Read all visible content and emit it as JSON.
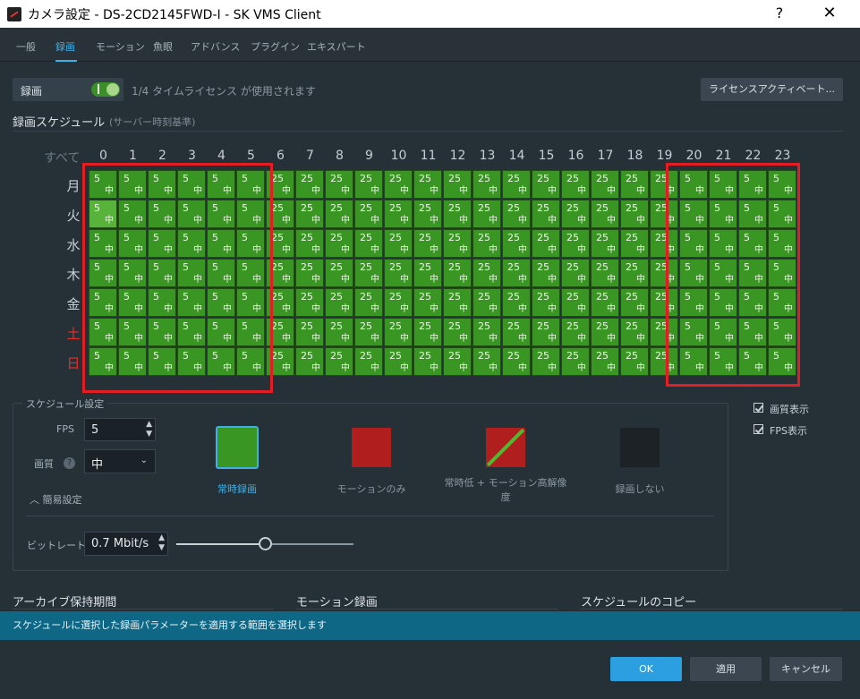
{
  "window": {
    "title": "カメラ設定 - DS-2CD2145FWD-I - SK VMS Client",
    "help_glyph": "?",
    "close_glyph": "✕"
  },
  "tabs": [
    "一般",
    "録画",
    "モーション",
    "魚眼",
    "アドバンス",
    "プラグイン",
    "エキスパート"
  ],
  "active_tab": "録画",
  "record": {
    "label": "録画",
    "enabled": true,
    "license_text": "1/4 タイムライセンス が使用されます",
    "license_button": "ライセンスアクティベート..."
  },
  "schedule": {
    "title": "録画スケジュール",
    "subtitle": "(サーバー時刻基準)",
    "all_label": "すべて",
    "hours": [
      "0",
      "1",
      "2",
      "3",
      "4",
      "5",
      "6",
      "7",
      "8",
      "9",
      "10",
      "11",
      "12",
      "13",
      "14",
      "15",
      "16",
      "17",
      "18",
      "19",
      "20",
      "21",
      "22",
      "23"
    ],
    "days": [
      "月",
      "火",
      "水",
      "木",
      "金",
      "土",
      "日"
    ],
    "weekend_days": [
      "土",
      "日"
    ],
    "fps_per_hour": [
      5,
      5,
      5,
      5,
      5,
      5,
      25,
      25,
      25,
      25,
      25,
      25,
      25,
      25,
      25,
      25,
      25,
      25,
      25,
      25,
      5,
      5,
      5,
      5
    ],
    "quality_label": "中",
    "cell_color": "#3a9623",
    "highlight_color": "#e31d24"
  },
  "display_options": {
    "quality": "画質表示",
    "fps": "FPS表示"
  },
  "settings": {
    "title": "スケジュール設定",
    "fps_label": "FPS",
    "fps_value": "5",
    "quality_label": "画質",
    "quality_value": "中",
    "simple_settings": "簡易設定",
    "bitrate_label": "ビットレート",
    "bitrate_value": "0.7 Mbit/s",
    "bitrate_level": 0.5,
    "modes": [
      {
        "label": "常時録画",
        "color": "#3a9623"
      },
      {
        "label": "モーションのみ",
        "color": "#b01e1e"
      },
      {
        "label": "常時低 + モーション高解像度",
        "color": "#b01e1e"
      },
      {
        "label": "録画しない",
        "color": "#1c2226"
      }
    ],
    "selected_mode": "常時録画"
  },
  "sections": {
    "archive": "アーカイブ保持期間",
    "motion": "モーション録画",
    "copy": "スケジュールのコピー"
  },
  "hint": "スケジュールに選択した録画パラメーターを適用する範囲を選択します",
  "buttons": {
    "ok": "OK",
    "apply": "適用",
    "cancel": "キャンセル"
  }
}
